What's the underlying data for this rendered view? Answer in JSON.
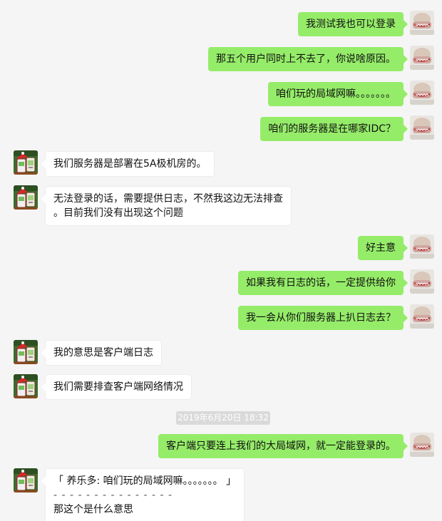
{
  "messages": [
    {
      "side": "right",
      "text": "我测试我也可以登录"
    },
    {
      "side": "right",
      "text": "那五个用户同时上不去了，你说啥原因。"
    },
    {
      "side": "right",
      "text": "咱们玩的局域网嘛。。。。。。。"
    },
    {
      "side": "right",
      "text": "咱们的服务器是在哪家IDC？"
    },
    {
      "side": "left",
      "text": "我们服务器是部署在5A极机房的。"
    },
    {
      "side": "left",
      "lines": [
        "无法登录的话，需要提供日志，不然我这边无法排查",
        "。目前我们没有出现这个问题"
      ]
    },
    {
      "side": "right",
      "text": "好主意"
    },
    {
      "side": "right",
      "text": "如果我有日志的话，一定提供给你"
    },
    {
      "side": "right",
      "text": "我一会从你们服务器上扒日志去？"
    },
    {
      "side": "left",
      "text": "我的意思是客户端日志"
    },
    {
      "side": "left",
      "text": "我们需要排查客户端网络情况"
    },
    {
      "side": "right",
      "text": "客户端只要连上我们的大局域网，就一定能登录的。"
    },
    {
      "side": "left",
      "lines": [
        "「 养乐多: 咱们玩的局域网嘛。。。。。。。 」",
        "- - - - - - - - - - - - - - -",
        "那这个是什么意思"
      ]
    }
  ],
  "timestamp": "2019年6月20日 18:32",
  "colors": {
    "background": "#f5f5f5",
    "self_bubble": "#95ec69",
    "other_bubble": "#ffffff",
    "timestamp_bg": "#dadada"
  },
  "avatars": {
    "self": "face-avatar-icon",
    "other": "christmas-cup-avatar-icon"
  }
}
